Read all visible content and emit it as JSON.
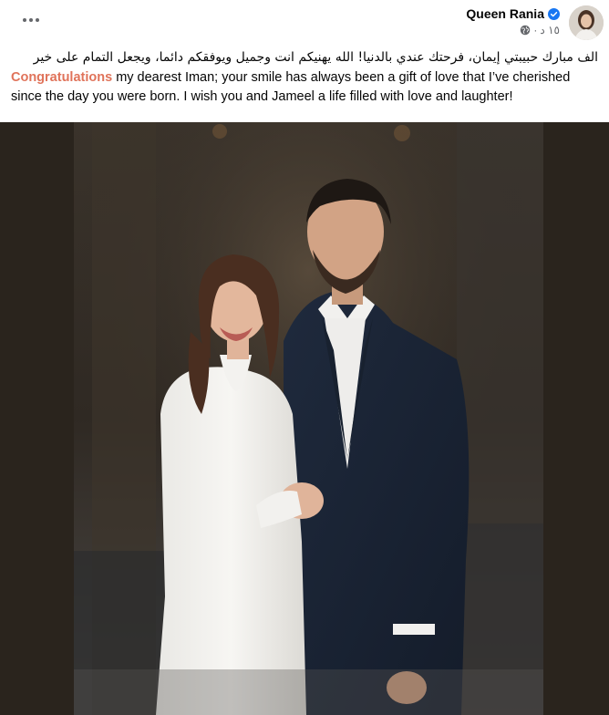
{
  "post": {
    "author_name": "Queen Rania",
    "verified_icon": "verified-badge-icon",
    "time_label": "١٥ د",
    "separator": "·",
    "audience_icon": "globe-icon",
    "more_icon": "more-options-icon",
    "arabic_text": "الف مبارك حبيبتي إيمان، فرحتك عندي بالدنيا! الله يهنيكم انت وجميل ويوفقكم دائما، ويجعل التمام على خير",
    "english_highlight": "Congratulations",
    "english_text": " my dearest Iman; your smile has always been a gift of love that I’ve cherished since the day you were born. I wish you and Jameel a life filled with love and laughter!"
  },
  "photo": {
    "description_icon": "couple-portrait-photo"
  },
  "colors": {
    "highlight": "#e0735a",
    "meta": "#65676b",
    "verified": "#1877f2",
    "photo_border": "#2a241d"
  }
}
